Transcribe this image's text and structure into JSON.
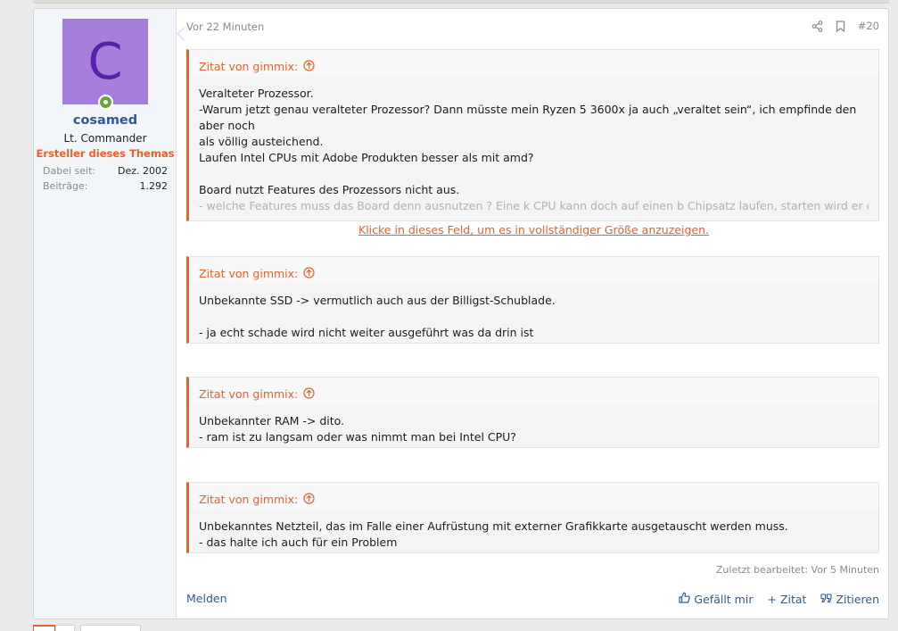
{
  "user": {
    "avatar_letter": "C",
    "name": "cosamed",
    "title": "Lt. Commander",
    "banner": "Ersteller dieses Themas",
    "stats": [
      {
        "label": "Dabei seit:",
        "value": "Dez. 2002"
      },
      {
        "label": "Beiträge:",
        "value": "1.292"
      }
    ]
  },
  "post": {
    "date": "Vor 22 Minuten",
    "number": "#20",
    "edited": "Zuletzt bearbeitet: Vor 5 Minuten",
    "report_label": "Melden",
    "like_label": "Gefällt mir",
    "quote_label": "+ Zitat",
    "cite_label": "Zitieren"
  },
  "quotes": [
    {
      "author": "Zitat von gimmix:",
      "lines": [
        "Veralteter Prozessor.",
        "-Warum jetzt genau veralteter Prozessor? Dann müsste mein Ryzen 5 3600x ja auch „veraltet sein“, ich empfinde den aber noch",
        "als völlig austeichend.",
        "Laufen Intel CPUs mit Adobe Produkten besser als mit amd?",
        "",
        "Board nutzt Features des Prozessors nicht aus."
      ],
      "faded_line": "- welche Features muss das Board denn ausnutzen ? Eine k CPU kann doch auf einen b Chipsatz laufen, starten wird er dennoch ...",
      "expand_text": "Klicke in dieses Feld, um es in vollständiger Größe anzuzeigen."
    },
    {
      "author": "Zitat von gimmix:",
      "lines": [
        "Unbekannte SSD -> vermutlich auch aus der Billigst-Schublade.",
        "",
        "- ja echt schade wird nicht weiter ausgeführt was da drin ist"
      ]
    },
    {
      "author": "Zitat von gimmix:",
      "lines": [
        "Unbekannter RAM -> dito.",
        "- ram ist zu langsam oder was nimmt man bei Intel CPU?"
      ]
    },
    {
      "author": "Zitat von gimmix:",
      "lines": [
        "Unbekanntes Netzteil, das im Falle einer Aufrüstung mit externer Grafikkarte ausgetauscht werden muss.",
        "- das halte ich auch für ein Problem"
      ]
    }
  ],
  "colors": {
    "accent": "#e8602c",
    "link": "#2f5a95",
    "avatar_bg": "#a67fdd",
    "online": "#6aa33a"
  }
}
